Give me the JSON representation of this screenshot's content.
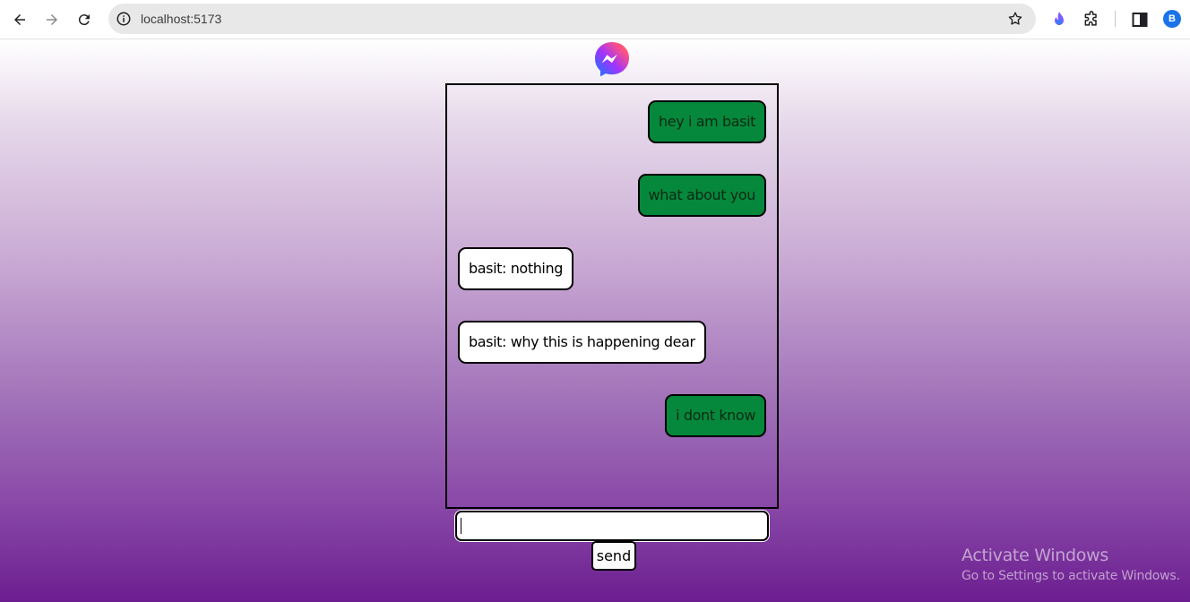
{
  "browser": {
    "url": "localhost:5173",
    "profile_initial": "B",
    "icons": [
      "back-arrow-icon",
      "forward-arrow-icon",
      "reload-icon",
      "info-icon",
      "star-icon",
      "extension-flame-icon",
      "puzzle-icon",
      "side-panel-icon"
    ]
  },
  "app": {
    "logo": "messenger-logo",
    "messages": [
      {
        "text": "hey i am basit",
        "side": "mine"
      },
      {
        "text": "what about you",
        "side": "mine"
      },
      {
        "text": "basit: nothing",
        "side": "theirs"
      },
      {
        "text": "basit: why this is happening dear",
        "side": "theirs"
      },
      {
        "text": "i dont know",
        "side": "mine"
      }
    ],
    "input_value": "",
    "send_label": "send"
  },
  "watermark": {
    "title": "Activate Windows",
    "subtitle": "Go to Settings to activate Windows."
  },
  "colors": {
    "mine_bubble": "#05883c",
    "theirs_bubble": "#ffffff",
    "gradient_bottom": "#6c1e90"
  }
}
